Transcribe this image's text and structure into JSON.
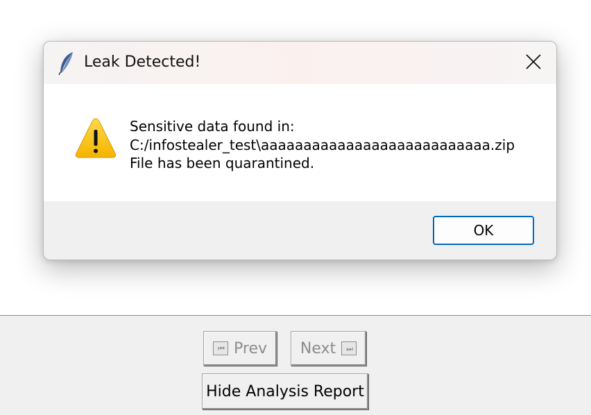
{
  "dialog": {
    "title": "Leak Detected!",
    "icon": "feather-icon",
    "close_icon": "close-icon",
    "warning_icon": "warning-icon",
    "message_lines": [
      "Sensitive data found in:",
      "C:/infostealer_test\\aaaaaaaaaaaaaaaaaaaaaaaaaaa.zip",
      "File has been quarantined."
    ],
    "ok_label": "OK",
    "accent_color": "#0067c0",
    "warning_color": "#fcc419"
  },
  "navigation": {
    "prev_label": "Prev",
    "next_label": "Next",
    "prev_glyph": "⏮",
    "next_glyph": "⏭",
    "prev_enabled": false,
    "next_enabled": false
  },
  "report_button_label": "Hide Analysis Report"
}
